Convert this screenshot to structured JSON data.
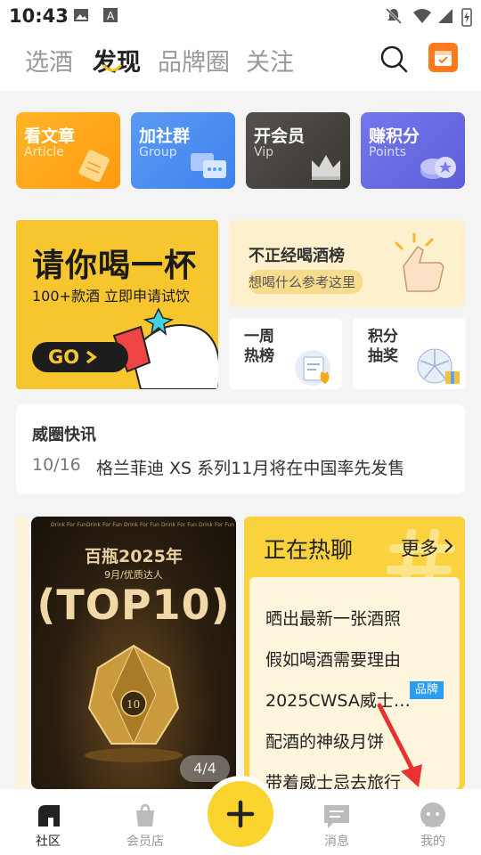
{
  "status": {
    "time": "10:43"
  },
  "tabs": [
    {
      "label": "选酒"
    },
    {
      "label": "发现"
    },
    {
      "label": "品牌圈"
    },
    {
      "label": "关注"
    }
  ],
  "quick": [
    {
      "title": "看文章",
      "sub": "Article",
      "color": "#ffad1a",
      "icon": "article-icon"
    },
    {
      "title": "加社群",
      "sub": "Group",
      "color": "#4d8ff0",
      "icon": "chat-icon"
    },
    {
      "title": "开会员",
      "sub": "Vip",
      "color": "#4a4642",
      "icon": "crown-icon"
    },
    {
      "title": "赚积分",
      "sub": "Points",
      "color": "#6a6ce0",
      "icon": "coin-icon"
    }
  ],
  "promo": {
    "headline": "请你喝一杯",
    "sub": "100+款酒 立即申请试饮",
    "go": "GO"
  },
  "rank": {
    "title": "不正经喝酒榜",
    "sub": "想喝什么参考这里"
  },
  "weekly": {
    "title": "一周热榜"
  },
  "points_lottery": {
    "title": "积分抽奖"
  },
  "news": {
    "heading": "威圈快讯",
    "date": "10/16",
    "text": "格兰菲迪 XS 系列11月将在中国率先发售"
  },
  "poster": {
    "tagline": "Drink For Fun",
    "line1": "百瓶2025年",
    "line2": "9月/优质达人",
    "line3": "(TOP10)",
    "counter": "4/4"
  },
  "hot": {
    "title": "正在热聊",
    "more": "更多",
    "items": [
      "晒出最新一张酒照",
      "假如喝酒需要理由",
      "2025CWSA威士…",
      "配酒的神级月饼",
      "带着威士忌去旅行"
    ],
    "badge": "品牌"
  },
  "bottomnav": [
    {
      "label": "社区"
    },
    {
      "label": "会员店"
    },
    {
      "label": "消息"
    },
    {
      "label": "我的"
    }
  ]
}
